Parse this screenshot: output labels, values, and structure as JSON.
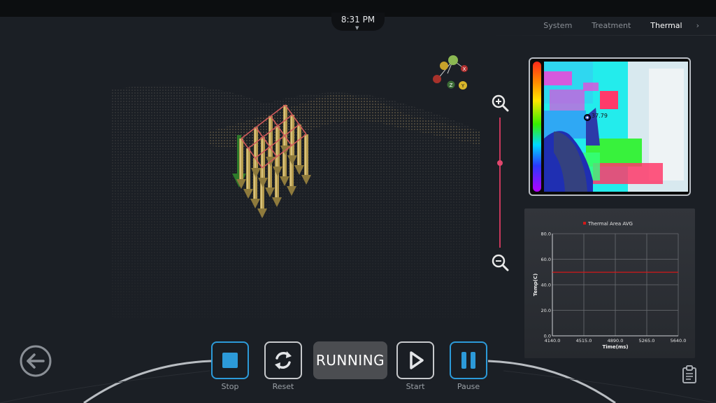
{
  "status_bar": {
    "time": "8:31 PM"
  },
  "tabs": [
    {
      "label": "System",
      "active": false
    },
    {
      "label": "Treatment",
      "active": false
    },
    {
      "label": "Thermal",
      "active": true
    }
  ],
  "axis_gizmo": {
    "x_label": "X",
    "y_label": "Y",
    "z_label": "Z"
  },
  "thermal": {
    "readout": "37.79"
  },
  "zoom": {
    "level": 0.65
  },
  "controls": {
    "stop_label": "Stop",
    "reset_label": "Reset",
    "status": "RUNNING",
    "start_label": "Start",
    "pause_label": "Pause"
  },
  "colors": {
    "accent": "#2c9ad9",
    "zoom_slider": "#e0476d",
    "series_line": "#d21919"
  },
  "chart_data": {
    "type": "line",
    "legend": "Thermal Area AVG",
    "xlabel": "Time(ms)",
    "ylabel": "Temp(C)",
    "xlim": [
      4140.0,
      5640.0
    ],
    "ylim": [
      0.0,
      80.0
    ],
    "x_ticks": [
      "4140.0",
      "4515.0",
      "4890.0",
      "5265.0",
      "5640.0"
    ],
    "y_ticks": [
      "0.0",
      "20.0",
      "40.0",
      "60.0",
      "80.0"
    ],
    "series": [
      {
        "name": "Thermal Area AVG",
        "x": [
          4140.0,
          5640.0
        ],
        "y": [
          49.8,
          49.8
        ]
      }
    ]
  }
}
